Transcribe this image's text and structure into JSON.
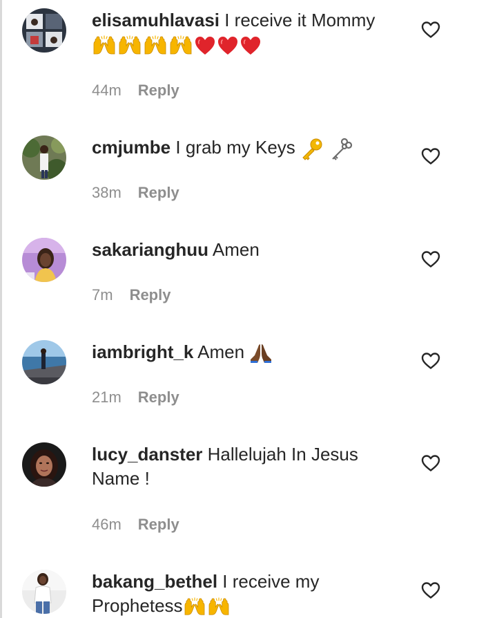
{
  "comments": [
    {
      "username": "elisamuhlavasi",
      "text": "I receive it Mommy",
      "emojis": [
        "raising-hands",
        "raising-hands",
        "raising-hands",
        "raising-hands",
        "red-heart",
        "red-heart",
        "red-heart"
      ],
      "time": "44m",
      "reply_label": "Reply",
      "like_icon": "heart-outline-icon"
    },
    {
      "username": "cmjumbe",
      "text": "I grab my Keys",
      "emojis": [
        "key",
        "old-key"
      ],
      "time": "38m",
      "reply_label": "Reply",
      "like_icon": "heart-outline-icon"
    },
    {
      "username": "sakarianghuu",
      "text": "Amen",
      "emojis": [],
      "time": "7m",
      "reply_label": "Reply",
      "like_icon": "heart-outline-icon"
    },
    {
      "username": "iambright_k",
      "text": "Amen",
      "emojis": [
        "folded-hands"
      ],
      "time": "21m",
      "reply_label": "Reply",
      "like_icon": "heart-outline-icon"
    },
    {
      "username": "lucy_danster",
      "text": "Hallelujah In Jesus Name !",
      "emojis": [],
      "time": "46m",
      "reply_label": "Reply",
      "like_icon": "heart-outline-icon"
    },
    {
      "username": "bakang_bethel",
      "text": "I receive my Prophetess",
      "emojis": [
        "raising-hands",
        "raising-hands"
      ],
      "time": "",
      "reply_label": "",
      "like_icon": "heart-outline-icon"
    }
  ],
  "colors": {
    "text": "#262626",
    "meta": "#8e8e8e",
    "heart_emoji": "#e0242b",
    "hands_emoji": "#f7b500"
  }
}
